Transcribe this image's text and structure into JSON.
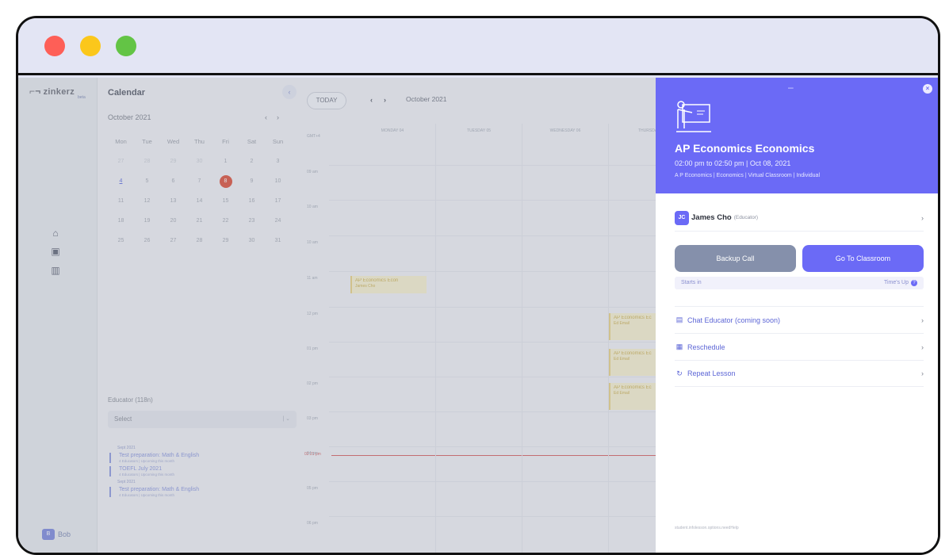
{
  "window": {
    "controls": [
      "close",
      "minimize",
      "zoom"
    ]
  },
  "brand": {
    "logo": "zinkerz",
    "badge": "beta"
  },
  "nav": {
    "icons": [
      "home-icon",
      "calendar-icon",
      "grid-icon"
    ]
  },
  "user": {
    "initial": "B",
    "name": "Bob"
  },
  "calendar": {
    "title": "Calendar",
    "collapse_label": "‹",
    "month_label": "October 2021",
    "weekdays": [
      "Mon",
      "Tue",
      "Wed",
      "Thu",
      "Fri",
      "Sat",
      "Sun"
    ],
    "weeks": [
      [
        "27",
        "28",
        "29",
        "30",
        "1",
        "2",
        "3"
      ],
      [
        "4",
        "5",
        "6",
        "7",
        "8",
        "9",
        "10"
      ],
      [
        "11",
        "12",
        "13",
        "14",
        "15",
        "16",
        "17"
      ],
      [
        "18",
        "19",
        "20",
        "21",
        "22",
        "23",
        "24"
      ],
      [
        "25",
        "26",
        "27",
        "28",
        "29",
        "30",
        "31"
      ]
    ],
    "selected_day": "8",
    "today_day": "4"
  },
  "filter": {
    "educator_label": "Educator (118n)",
    "select_placeholder": "Select"
  },
  "lessons_list": [
    {
      "date": "Sept 2021"
    },
    {
      "title": "Test preparation: Math & English",
      "sub": "4 Educators | Upcoming this month"
    },
    {
      "title": "TOEFL July 2021",
      "sub": "4 Educators | Upcoming this month"
    },
    {
      "date": "Sept 2021"
    },
    {
      "title": "Test preparation: Math & English",
      "sub": "4 Educators | Upcoming this month"
    }
  ],
  "week": {
    "today_btn": "TODAY",
    "month_label": "October 2021",
    "timezone": "GMT+4",
    "days": [
      "MONDAY 04",
      "TUESDAY 05",
      "WEDNESDAY 06",
      "THURSDAY 07"
    ],
    "hours": [
      "09 am",
      "10 am",
      "10 am",
      "11 am",
      "12 pm",
      "01 pm",
      "02 pm",
      "03 pm",
      "04 pm",
      "05 pm",
      "06 pm"
    ],
    "now_label": "02:21 pm",
    "events": [
      {
        "title": "AP Economics Econ",
        "sub": "James Cho"
      },
      {
        "title": "AP Economics Ec",
        "sub": "Ed Email"
      },
      {
        "title": "AP Economics Ec",
        "sub": "Ed Email"
      },
      {
        "title": "AP Economics Ec",
        "sub": "Ed Email"
      }
    ]
  },
  "modal": {
    "title": "AP Economics Economics",
    "time": "02:00 pm to 02:50 pm | Oct 08, 2021",
    "tags": "A P Economics | Economics | Virtual Classroom | Individual",
    "educator": {
      "initials": "JC",
      "name": "James Cho",
      "role": "(Educator)"
    },
    "backup_btn": "Backup Call",
    "classroom_btn": "Go To Classroom",
    "starts_in": "Starts in",
    "times_up": "Time's Up",
    "actions": [
      {
        "icon": "chat-icon",
        "label": "Chat Educator (coming soon)"
      },
      {
        "icon": "reschedule-icon",
        "label": "Reschedule"
      },
      {
        "icon": "repeat-icon",
        "label": "Repeat Lesson"
      }
    ],
    "footer": "student.infolesson.options.needHelp"
  },
  "colors": {
    "accent": "#6b6af6",
    "event": "#f6efc6",
    "now": "#d14b4b",
    "selected": "#d8381e"
  }
}
